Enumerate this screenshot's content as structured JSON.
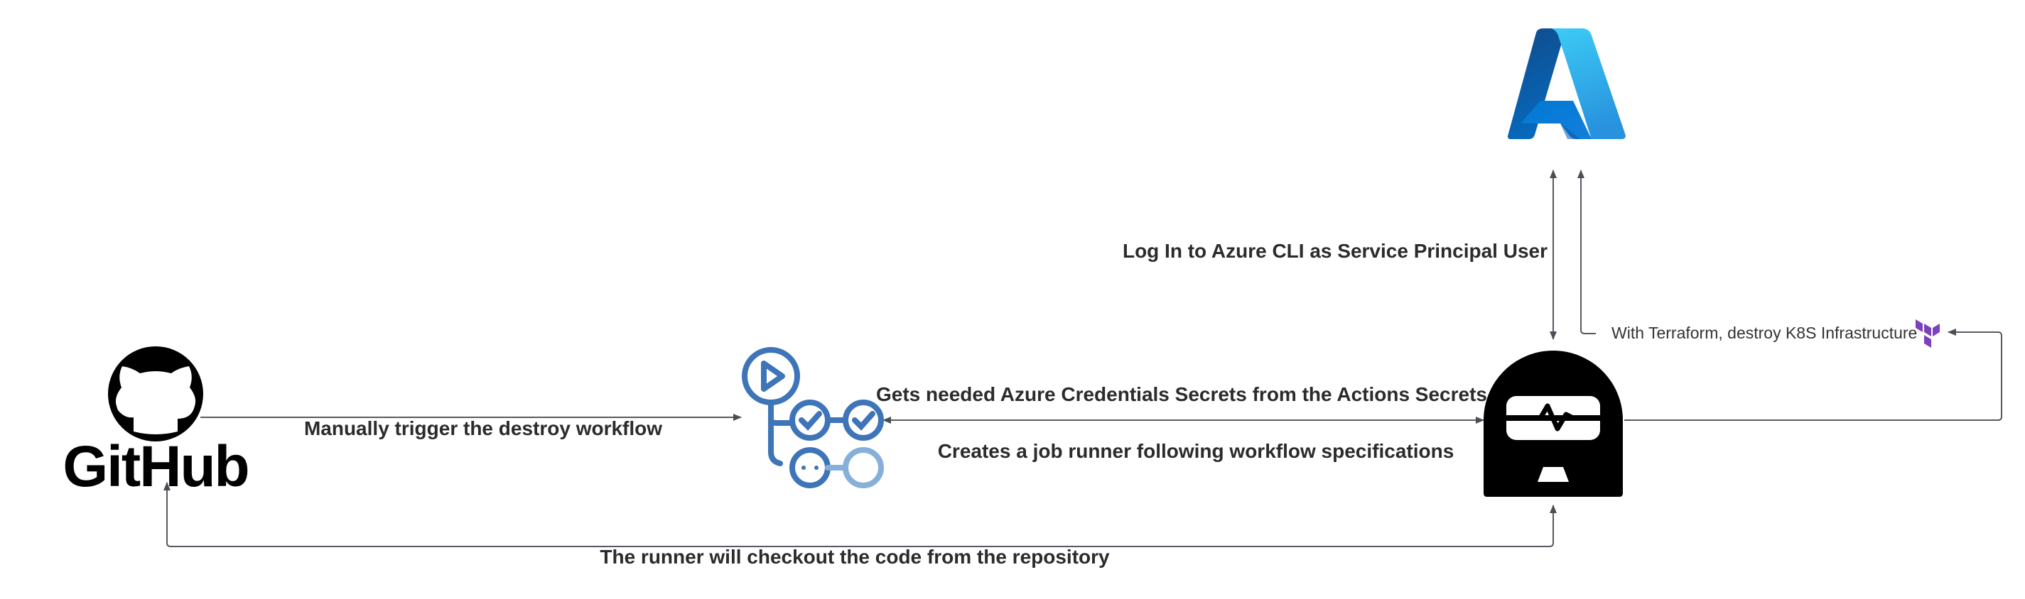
{
  "diagram": {
    "nodes": {
      "github": {
        "label": "GitHub",
        "icon": "github-octocat-icon"
      },
      "actions": {
        "icon": "github-actions-workflow-icon",
        "color_primary": "#3e74b8",
        "color_secondary": "#86afd9"
      },
      "runner": {
        "icon": "job-runner-icon",
        "color": "#000000"
      },
      "azure": {
        "icon": "azure-logo-icon",
        "color_dark": "#0a5cb4",
        "color_light": "#36b4ec"
      },
      "terraform": {
        "icon": "terraform-icon",
        "color": "#7b42bc"
      }
    },
    "edges": {
      "trigger": "Manually trigger the destroy workflow",
      "secrets": "Gets needed Azure Credentials Secrets from the Actions Secrets",
      "runner_create": "Creates a job runner following workflow specifications",
      "checkout": "The runner will checkout the code from the repository",
      "login": "Log In to Azure CLI as Service Principal User",
      "terraform": "With Terraform, destroy K8S Infrastructure"
    },
    "colors": {
      "connector": "#555a60",
      "label": "#2b2b2b"
    }
  }
}
